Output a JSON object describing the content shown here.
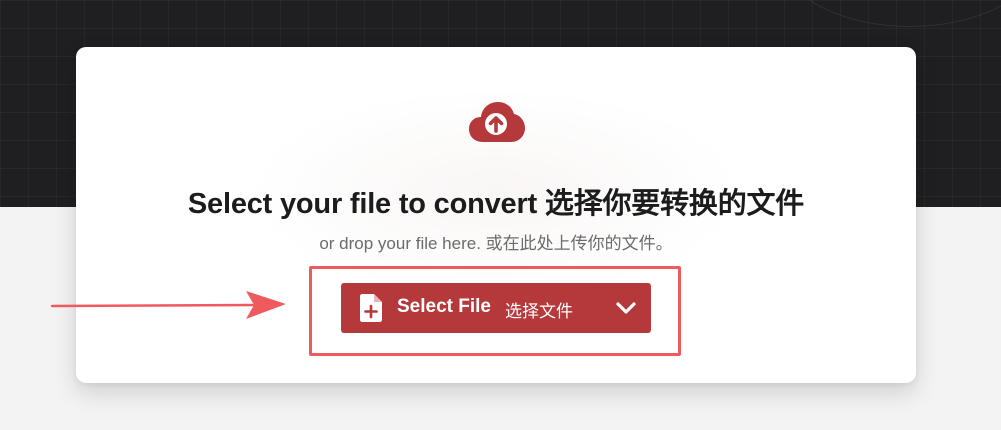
{
  "upload": {
    "title": "Select your file to convert 选择你要转换的文件",
    "subtitle": "or drop your file here. 或在此处上传你的文件。",
    "button_label": "Select File",
    "button_label_cn": "选择文件",
    "upload_icon": "cloud-upload-icon",
    "file_icon": "file-plus-icon",
    "dropdown_icon": "chevron-down-icon"
  },
  "annotation": {
    "pointer_icon": "arrow-right-icon",
    "highlight_color": "#ef5a5f"
  },
  "colors": {
    "accent": "#b5383a",
    "dark_background": "#1f1f21",
    "light_background": "#f3f3f3",
    "card": "#ffffff",
    "title_text": "#1c1c1c",
    "subtitle_text": "#6b6b6b"
  }
}
